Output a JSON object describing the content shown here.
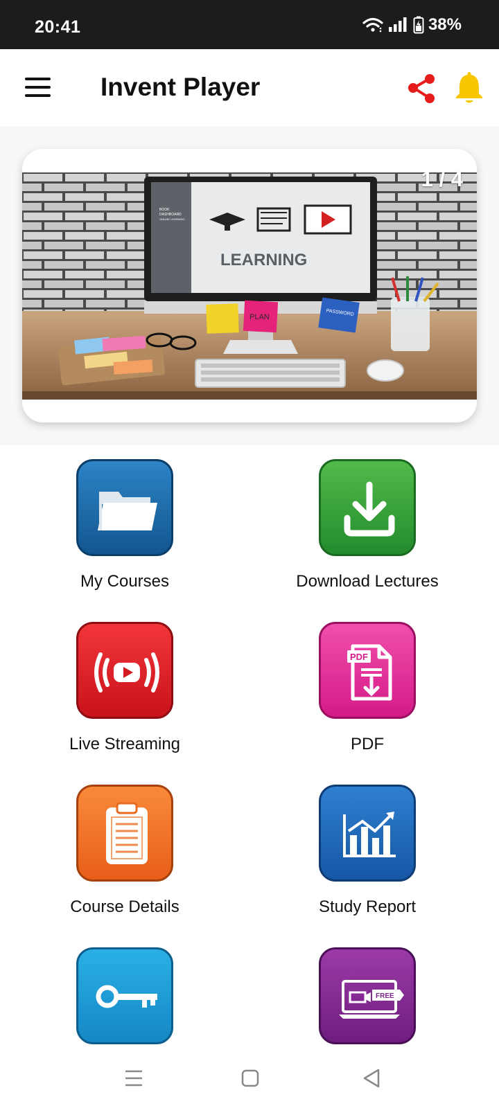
{
  "status_bar": {
    "time": "20:41",
    "battery": "38%",
    "icons": [
      "wifi-icon",
      "signal-icon",
      "battery-icon"
    ]
  },
  "app_bar": {
    "title": "Invent Player",
    "icons": [
      "menu-icon",
      "share-icon",
      "bell-icon"
    ],
    "share_color": "#e61b1b",
    "bell_color": "#f7c600"
  },
  "banner": {
    "counter": "1 / 4",
    "image_text": {
      "heading": "LEARNING",
      "sidebar_line1": "BOOK",
      "sidebar_line2": "DASHBOARD",
      "sidebar_line3": "ONLINE LEARNING",
      "note1": "PLAN",
      "note2": "PASSWORD"
    }
  },
  "menu_tiles": [
    {
      "label": "My Courses",
      "icon": "folder-icon",
      "color_top": "#2d84c6",
      "color_bottom": "#12568f"
    },
    {
      "label": "Download Lectures",
      "icon": "download-icon",
      "color_top": "#52ba4a",
      "color_bottom": "#238b2d"
    },
    {
      "label": "Live Streaming",
      "icon": "live-stream-icon",
      "color_top": "#f2363a",
      "color_bottom": "#c9121a"
    },
    {
      "label": "PDF",
      "icon": "pdf-icon",
      "color_top": "#f04fae",
      "color_bottom": "#d41a86"
    },
    {
      "label": "Course Details",
      "icon": "clipboard-icon",
      "color_top": "#f98a3a",
      "color_bottom": "#e85e1a"
    },
    {
      "label": "Study Report",
      "icon": "chart-icon",
      "color_top": "#2f7fd0",
      "color_bottom": "#1657a6"
    },
    {
      "label": "",
      "icon": "key-icon",
      "color_top": "#2ab0e4",
      "color_bottom": "#1487c5"
    },
    {
      "label": "",
      "icon": "free-video-icon",
      "color_top": "#9c3aa8",
      "color_bottom": "#6e1d7e",
      "badge": "FREE"
    }
  ],
  "nav_bar": {
    "icons": [
      "recent-apps-icon",
      "home-icon",
      "back-icon"
    ]
  }
}
